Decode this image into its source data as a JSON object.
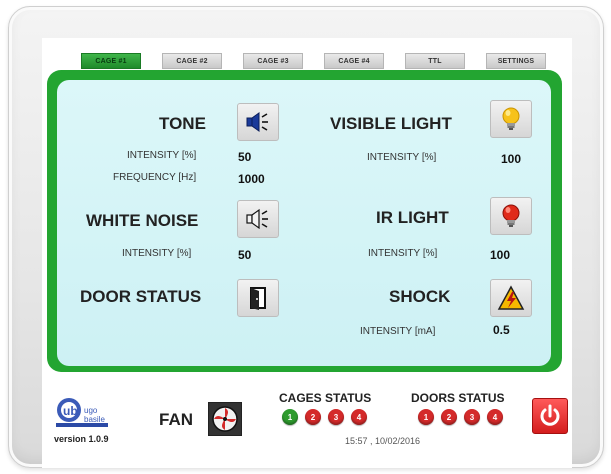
{
  "tabs": [
    {
      "label": "CAGE #1",
      "active": true
    },
    {
      "label": "CAGE #2",
      "active": false
    },
    {
      "label": "CAGE #3",
      "active": false
    },
    {
      "label": "CAGE #4",
      "active": false
    },
    {
      "label": "TTL",
      "active": false
    },
    {
      "label": "SETTINGS",
      "active": false
    }
  ],
  "tone": {
    "title": "TONE",
    "intensity_label": "INTENSITY [%]",
    "intensity": "50",
    "frequency_label": "FREQUENCY [Hz]",
    "frequency": "1000",
    "icon": "speaker-on-icon"
  },
  "white_noise": {
    "title": "WHITE NOISE",
    "intensity_label": "INTENSITY [%]",
    "intensity": "50",
    "icon": "speaker-on-icon"
  },
  "door": {
    "title": "DOOR STATUS",
    "icon": "door-icon"
  },
  "visible_light": {
    "title": "VISIBLE LIGHT",
    "intensity_label": "INTENSITY [%]",
    "intensity": "100",
    "icon": "lightbulb-yellow-icon"
  },
  "ir_light": {
    "title": "IR LIGHT",
    "intensity_label": "INTENSITY [%]",
    "intensity": "100",
    "icon": "lightbulb-red-icon"
  },
  "shock": {
    "title": "SHOCK",
    "intensity_label": "INTENSITY [mA]",
    "intensity": "0.5",
    "icon": "lightning-icon"
  },
  "footer": {
    "logo_text": "ugo basile",
    "version": "version 1.0.9",
    "fan_label": "FAN",
    "cages_status_title": "CAGES STATUS",
    "doors_status_title": "DOORS STATUS",
    "cages": [
      {
        "n": "1",
        "color": "#2e9b2e"
      },
      {
        "n": "2",
        "color": "#d42a2a"
      },
      {
        "n": "3",
        "color": "#d42a2a"
      },
      {
        "n": "4",
        "color": "#d42a2a"
      }
    ],
    "doors": [
      {
        "n": "1",
        "color": "#d42a2a"
      },
      {
        "n": "2",
        "color": "#d42a2a"
      },
      {
        "n": "3",
        "color": "#d42a2a"
      },
      {
        "n": "4",
        "color": "#d42a2a"
      }
    ],
    "datetime": "15:57 , 10/02/2016"
  },
  "colors": {
    "panel_green": "#23a531",
    "panel_inner": "#d3f4f6",
    "power_red": "#e03030"
  }
}
